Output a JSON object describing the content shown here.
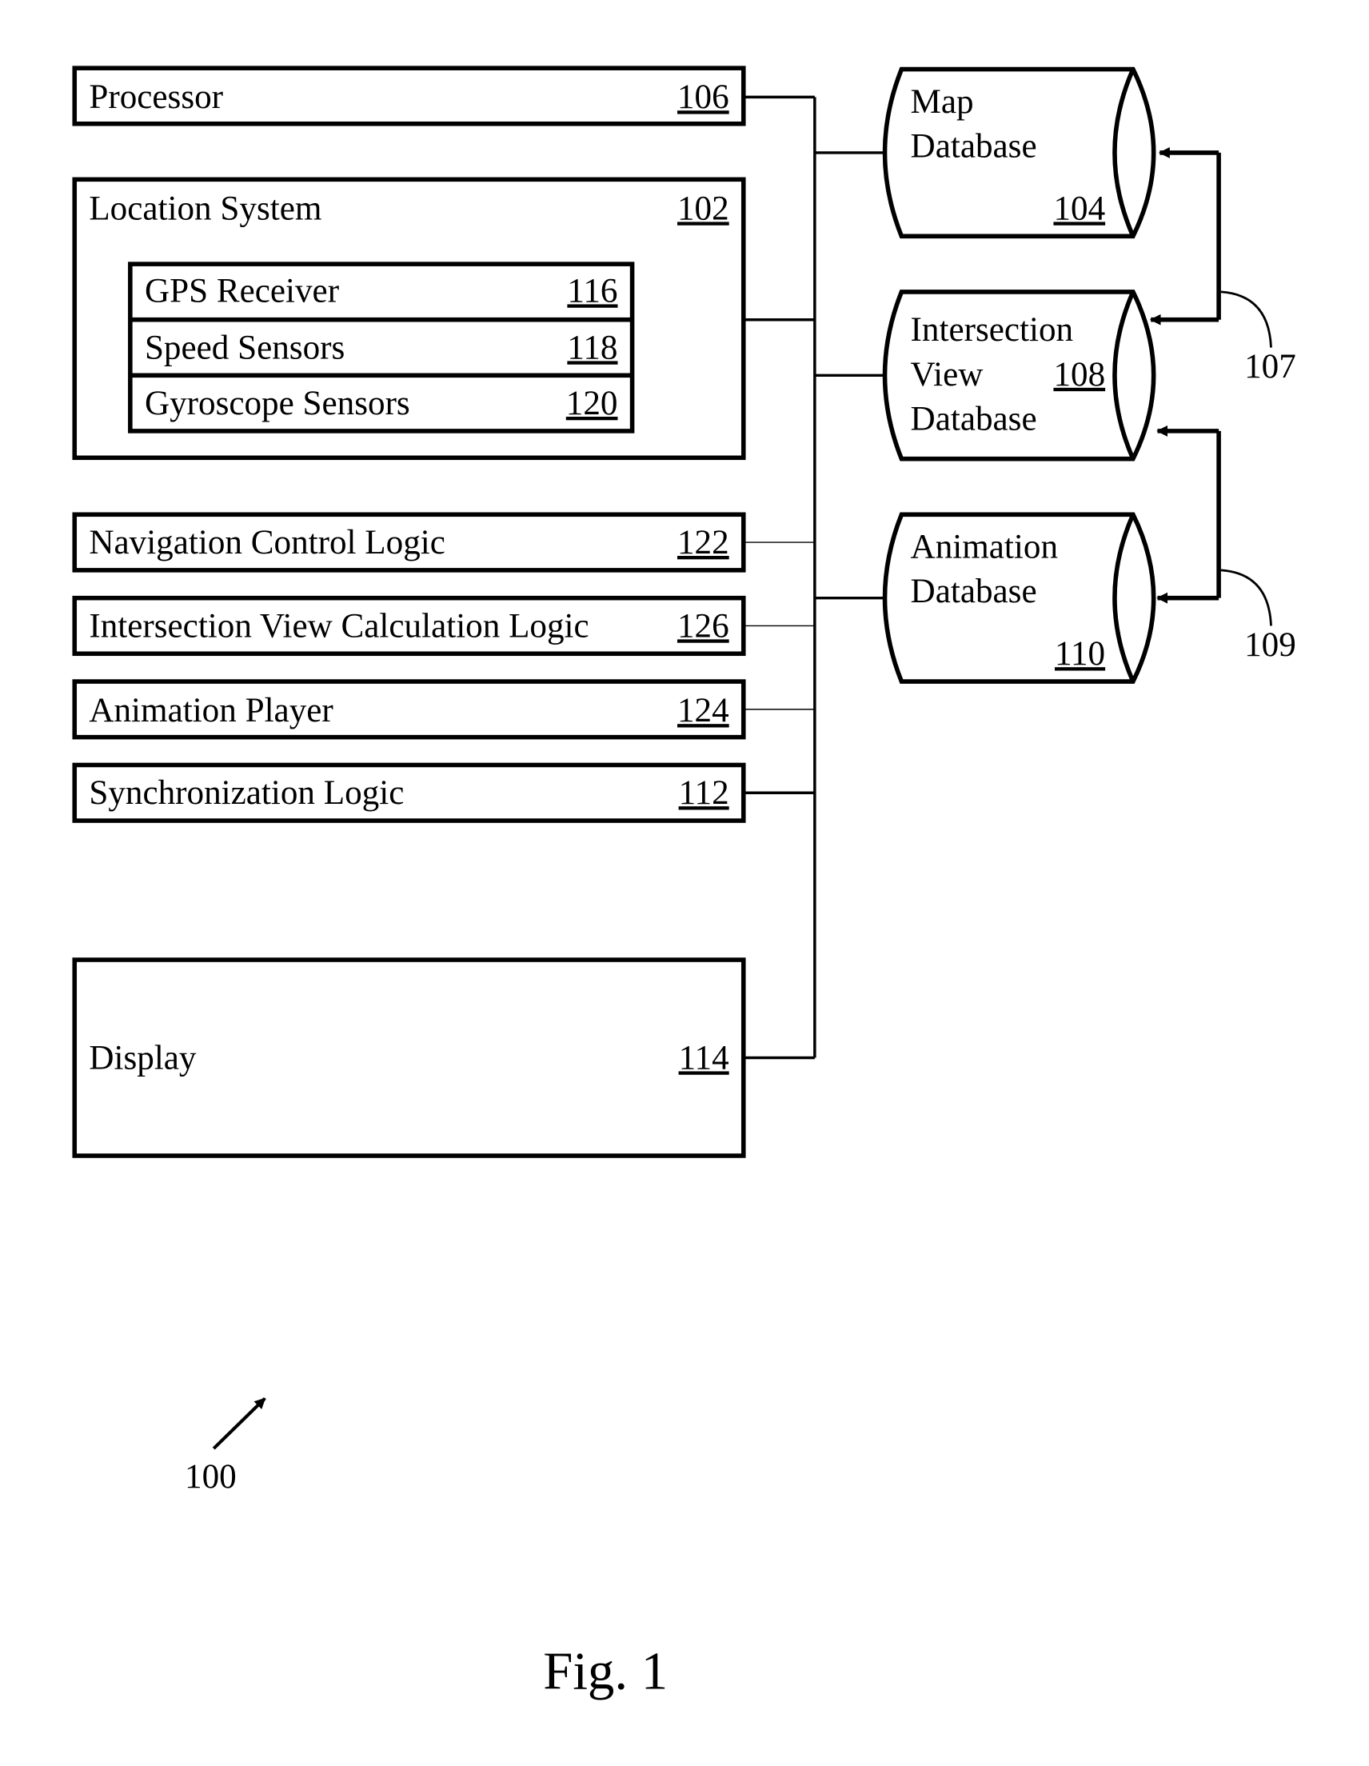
{
  "figure": {
    "caption": "Fig. 1",
    "system_ref": "100"
  },
  "blocks": {
    "processor": {
      "label": "Processor",
      "ref": "106"
    },
    "location_system": {
      "label": "Location System",
      "ref": "102"
    },
    "gps_receiver": {
      "label": "GPS Receiver",
      "ref": "116"
    },
    "speed_sensors": {
      "label": "Speed Sensors",
      "ref": "118"
    },
    "gyroscope_sensors": {
      "label": "Gyroscope Sensors",
      "ref": "120"
    },
    "navigation_control_logic": {
      "label": "Navigation Control Logic",
      "ref": "122"
    },
    "intersection_view_calculation_logic": {
      "label": "Intersection View Calculation Logic",
      "ref": "126"
    },
    "animation_player": {
      "label": "Animation Player",
      "ref": "124"
    },
    "synchronization_logic": {
      "label": "Synchronization Logic",
      "ref": "112"
    },
    "display": {
      "label": "Display",
      "ref": "114"
    }
  },
  "databases": {
    "map": {
      "line1": "Map",
      "line2": "Database",
      "ref": "104"
    },
    "intersection_view": {
      "line1": "Intersection",
      "line2": "View",
      "line3": "Database",
      "ref": "108"
    },
    "animation": {
      "line1": "Animation",
      "line2": "Database",
      "ref": "110"
    }
  },
  "connections": {
    "link_107": "107",
    "link_109": "109"
  }
}
